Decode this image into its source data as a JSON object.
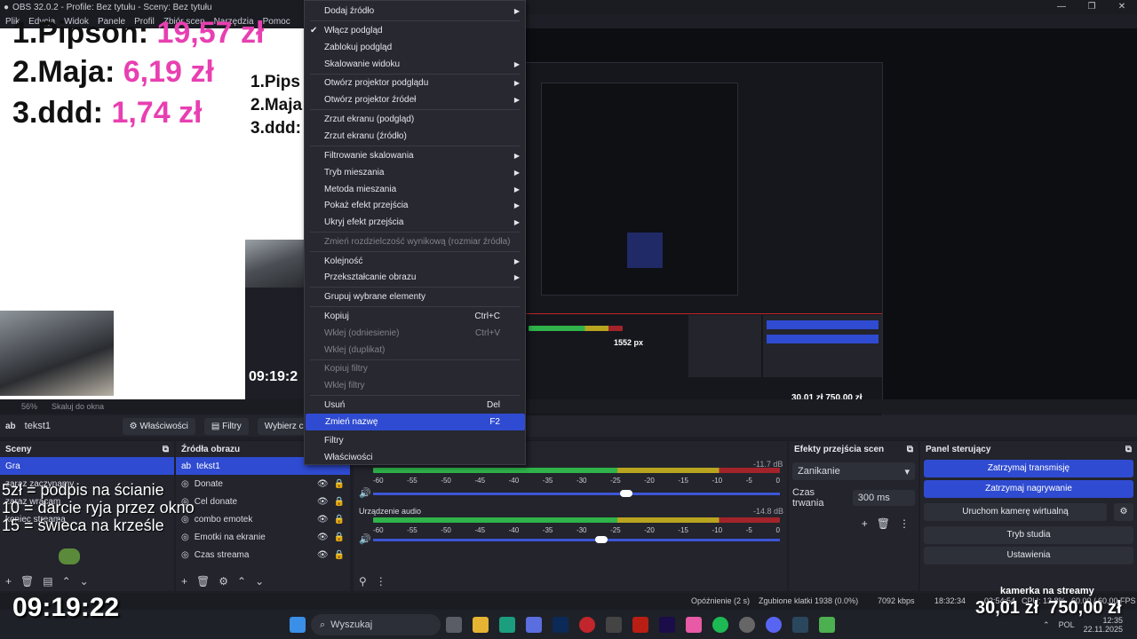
{
  "window": {
    "title": "OBS 32.0.2 - Profile: Bez tytułu - Sceny: Bez tytułu"
  },
  "menubar": [
    "Plik",
    "Edycja",
    "Widok",
    "Panele",
    "Profil",
    "Zbiór scen",
    "Narzędzia",
    "Pomoc"
  ],
  "ranking": [
    {
      "label": "1.Pipson:",
      "amount": "19,57 zł"
    },
    {
      "label": "2.Maja:",
      "amount": "6,19 zł"
    },
    {
      "label": "3.ddd:",
      "amount": "1,74 zł"
    }
  ],
  "inner_ranking": [
    "1.Pips",
    "2.Maja",
    "3.ddd:"
  ],
  "preview_bar": {
    "zoom": "56%",
    "scale": "Skaluj do okna"
  },
  "source_toolbar": {
    "source_name": "tekst1",
    "properties": "Właściwości",
    "filters": "Filtry",
    "select": "Wybierz czcionkę"
  },
  "context_menu": {
    "items": [
      {
        "label": "Dodaj źródło",
        "submenu": true
      },
      {
        "label": "Włącz podgląd",
        "checked": true
      },
      {
        "label": "Zablokuj podgląd"
      },
      {
        "label": "Skalowanie widoku",
        "submenu": true
      },
      {
        "label": "Otwórz projektor podglądu",
        "submenu": true
      },
      {
        "label": "Otwórz projektor źródeł",
        "submenu": true
      },
      {
        "label": "Zrzut ekranu (podgląd)"
      },
      {
        "label": "Zrzut ekranu (źródło)"
      },
      {
        "label": "Filtrowanie skalowania",
        "submenu": true
      },
      {
        "label": "Tryb mieszania",
        "submenu": true
      },
      {
        "label": "Metoda mieszania",
        "submenu": true
      },
      {
        "label": "Pokaż efekt przejścia",
        "submenu": true
      },
      {
        "label": "Ukryj efekt przejścia",
        "submenu": true
      },
      {
        "label": "Zmień rozdzielczość wynikową (rozmiar źródła)",
        "disabled": true
      },
      {
        "label": "Kolejność",
        "submenu": true
      },
      {
        "label": "Przekształcanie obrazu",
        "submenu": true
      },
      {
        "label": "Grupuj wybrane elementy"
      },
      {
        "label": "Kopiuj",
        "shortcut": "Ctrl+C"
      },
      {
        "label": "Wklej (odniesienie)",
        "shortcut": "Ctrl+V",
        "disabled": true
      },
      {
        "label": "Wklej (duplikat)",
        "disabled": true
      },
      {
        "label": "Kopiuj filtry",
        "disabled": true
      },
      {
        "label": "Wklej filtry",
        "disabled": true
      },
      {
        "label": "Usuń",
        "shortcut": "Del"
      },
      {
        "label": "Zmień nazwę",
        "shortcut": "F2",
        "highlighted": true
      },
      {
        "label": "Filtry"
      },
      {
        "label": "Właściwości"
      }
    ]
  },
  "scenes": {
    "title": "Sceny",
    "items": [
      "Gra",
      "zaraz zaczynamy",
      "zaraz wracam",
      "koniec streama"
    ]
  },
  "sources": {
    "title": "Źródła obrazu",
    "items": [
      "tekst1",
      "Donate",
      "Cel donate",
      "combo emotek",
      "Emotki na ekranie",
      "Czas streama"
    ]
  },
  "mixer": {
    "tracks": [
      {
        "name": "",
        "db": "-11.7 dB",
        "level": 0.72
      },
      {
        "name": "Urządzenie audio",
        "db": "-14.8 dB",
        "level": 0.58
      }
    ],
    "ticks": [
      "-60",
      "-55",
      "-50",
      "-45",
      "-40",
      "-35",
      "-30",
      "-25",
      "-20",
      "-15",
      "-10",
      "-5",
      "0"
    ]
  },
  "transitions": {
    "title": "Efekty przejścia scen",
    "effect": "Zanikanie",
    "duration_label": "Czas trwania",
    "duration": "300 ms"
  },
  "controls": {
    "title": "Panel sterujący",
    "buttons": [
      "Zatrzymaj transmisję",
      "Zatrzymaj nagrywanie",
      "Uruchom kamerę wirtualną",
      "Tryb studia",
      "Ustawienia"
    ]
  },
  "overlay": {
    "caption": [
      "5zł = podpis na ścianie",
      "10 = darcie ryja przez okno",
      "15 = świeca na krześle"
    ],
    "clock": "09:19:22",
    "inner_clock": "09:19:2",
    "camera_label": "kamerka na streamy",
    "amount_left": "30,01 zł",
    "amount_right": "750,00 zł"
  },
  "statusbar": {
    "delay": "Opóźnienie (2 s)",
    "dropped": "Zgubione klatki 1938 (0.0%)",
    "bitrate": "7092 kbps",
    "stream_time": "18:32:34",
    "rec_time": "02:54:54",
    "cpu": "CPU: 13.8%",
    "fps": "60.00 / 60.00 FPS"
  },
  "taskbar": {
    "search": "Wyszukaj",
    "lang": "POL",
    "time": "12:35",
    "date": "22.11.2025"
  },
  "inner_preview": {
    "px": "1552 px",
    "px_small": "1552 px"
  }
}
